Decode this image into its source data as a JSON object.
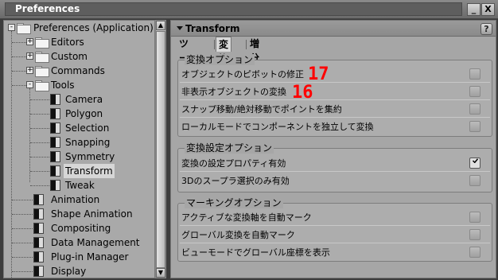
{
  "window": {
    "title": "Preferences",
    "minimize_label": "_",
    "close_label": "X"
  },
  "tree": {
    "root": {
      "label": "Preferences (Application)",
      "expander": "-"
    },
    "folders": [
      {
        "label": "Editors",
        "expander": "+"
      },
      {
        "label": "Custom",
        "expander": "+"
      },
      {
        "label": "Commands",
        "expander": "+"
      },
      {
        "label": "Tools",
        "expander": "-"
      }
    ],
    "tools_children": [
      "Camera",
      "Polygon",
      "Selection",
      "Snapping",
      "Symmetry",
      "Transform",
      "Tweak"
    ],
    "selected": "Transform",
    "root_pages": [
      "Animation",
      "Shape Animation",
      "Compositing",
      "Data Management",
      "Plug-in Manager",
      "Display"
    ]
  },
  "scrollbar": {
    "up": "▲",
    "down": "▼"
  },
  "panel": {
    "title": "Transform",
    "help": "?",
    "tabs": [
      "ツール",
      "変換",
      "増分"
    ],
    "active_tab": "変換"
  },
  "groups": [
    {
      "title": "変換オプション",
      "options": [
        {
          "label": "オブジェクトのピボットの修正",
          "checked": false
        },
        {
          "label": "非表示オブジェクトの変換",
          "checked": false
        },
        {
          "label": "スナップ移動/絶対移動でポイントを集約",
          "checked": false
        },
        {
          "label": "ローカルモードでコンポーネントを独立して変換",
          "checked": false
        }
      ]
    },
    {
      "title": "変換設定オプション",
      "options": [
        {
          "label": "変換の設定プロパティ有効",
          "checked": true
        },
        {
          "label": "3Dのスープラ選択のみ有効",
          "checked": false
        }
      ]
    },
    {
      "title": "マーキングオプション",
      "options": [
        {
          "label": "アクティブな変換軸を自動マーク",
          "checked": false
        },
        {
          "label": "グローバル変換を自動マーク",
          "checked": false
        },
        {
          "label": "ビューモードでグローバル座標を表示",
          "checked": false
        }
      ]
    }
  ],
  "annotations": [
    "17",
    "16"
  ],
  "colors": {
    "annotation": "#ff0000",
    "selected_row": "#d6d6d6"
  }
}
